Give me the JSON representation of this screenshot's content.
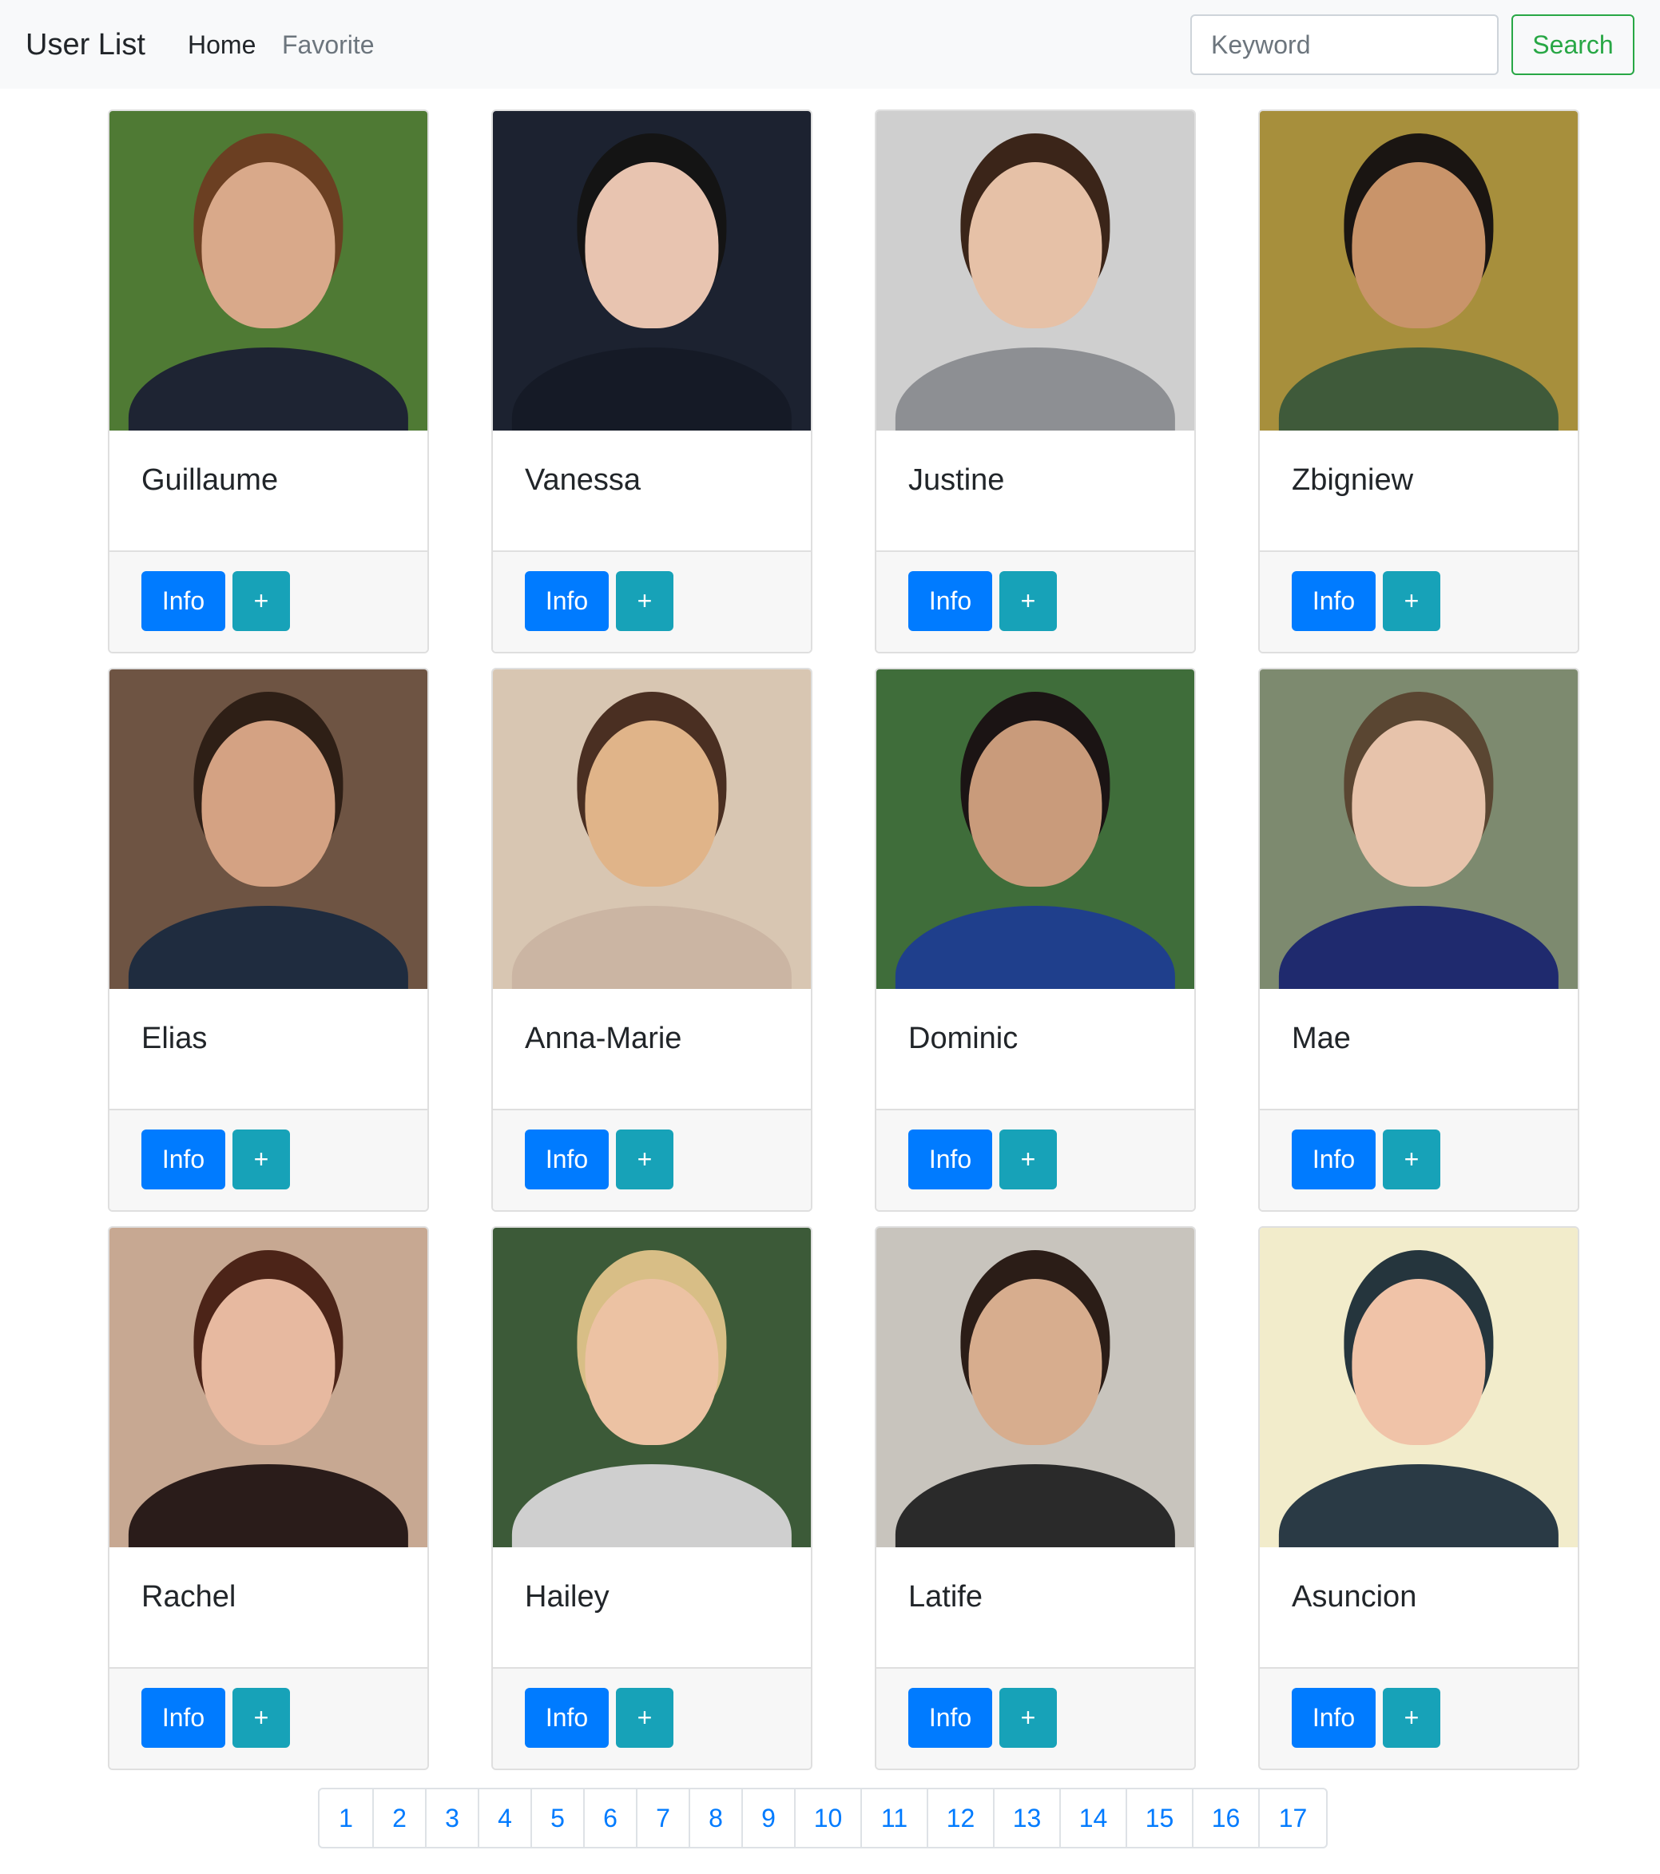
{
  "navbar": {
    "brand": "User List",
    "links": [
      {
        "label": "Home"
      },
      {
        "label": "Favorite"
      }
    ],
    "search": {
      "placeholder": "Keyword",
      "value": ""
    },
    "search_button": "Search"
  },
  "users": [
    {
      "name": "Guillaume",
      "info_label": "Info",
      "add_label": "+",
      "photo": {
        "bg": "#4f7a34",
        "skin": "#d9a98a",
        "hair": "#6b3f22",
        "clothes": "#1e2433"
      }
    },
    {
      "name": "Vanessa",
      "info_label": "Info",
      "add_label": "+",
      "photo": {
        "bg": "#1c2230",
        "skin": "#e8c4b0",
        "hair": "#141414",
        "clothes": "#151a26"
      }
    },
    {
      "name": "Justine",
      "info_label": "Info",
      "add_label": "+",
      "photo": {
        "bg": "#cfcfcf",
        "skin": "#e6c1a7",
        "hair": "#3b2519",
        "clothes": "#8d8f93"
      }
    },
    {
      "name": "Zbigniew",
      "info_label": "Info",
      "add_label": "+",
      "photo": {
        "bg": "#a78f3c",
        "skin": "#c9946a",
        "hair": "#1a1512",
        "clothes": "#3f5a3a"
      }
    },
    {
      "name": "Elias",
      "info_label": "Info",
      "add_label": "+",
      "photo": {
        "bg": "#6e5443",
        "skin": "#d4a283",
        "hair": "#2e1f16",
        "clothes": "#1f2c3f"
      }
    },
    {
      "name": "Anna-Marie",
      "info_label": "Info",
      "add_label": "+",
      "photo": {
        "bg": "#d8c6b2",
        "skin": "#e0b489",
        "hair": "#4a2f22",
        "clothes": "#cbb5a3"
      }
    },
    {
      "name": "Dominic",
      "info_label": "Info",
      "add_label": "+",
      "photo": {
        "bg": "#3f6d3a",
        "skin": "#c99b7b",
        "hair": "#1b1414",
        "clothes": "#1f3f8c"
      }
    },
    {
      "name": "Mae",
      "info_label": "Info",
      "add_label": "+",
      "photo": {
        "bg": "#7d8a6f",
        "skin": "#e7c3ab",
        "hair": "#5a4632",
        "clothes": "#1f2a6e"
      }
    },
    {
      "name": "Rachel",
      "info_label": "Info",
      "add_label": "+",
      "photo": {
        "bg": "#c7a892",
        "skin": "#e7b9a0",
        "hair": "#4c2418",
        "clothes": "#2a1c1a"
      }
    },
    {
      "name": "Hailey",
      "info_label": "Info",
      "add_label": "+",
      "photo": {
        "bg": "#3c5a38",
        "skin": "#ecc2a3",
        "hair": "#d8be86",
        "clothes": "#cfcfcf"
      }
    },
    {
      "name": "Latife",
      "info_label": "Info",
      "add_label": "+",
      "photo": {
        "bg": "#c8c4bd",
        "skin": "#d7ad8e",
        "hair": "#2b1d17",
        "clothes": "#2a2a2a"
      }
    },
    {
      "name": "Asuncion",
      "info_label": "Info",
      "add_label": "+",
      "photo": {
        "bg": "#f2eccb",
        "skin": "#f0c3a8",
        "hair": "#25353d",
        "clothes": "#2a3a45"
      }
    }
  ],
  "pagination": [
    "1",
    "2",
    "3",
    "4",
    "5",
    "6",
    "7",
    "8",
    "9",
    "10",
    "11",
    "12",
    "13",
    "14",
    "15",
    "16",
    "17"
  ],
  "colors": {
    "primary": "#007bff",
    "info": "#17a2b8",
    "success": "#28a745",
    "navbar_bg": "#f8f9fa"
  }
}
